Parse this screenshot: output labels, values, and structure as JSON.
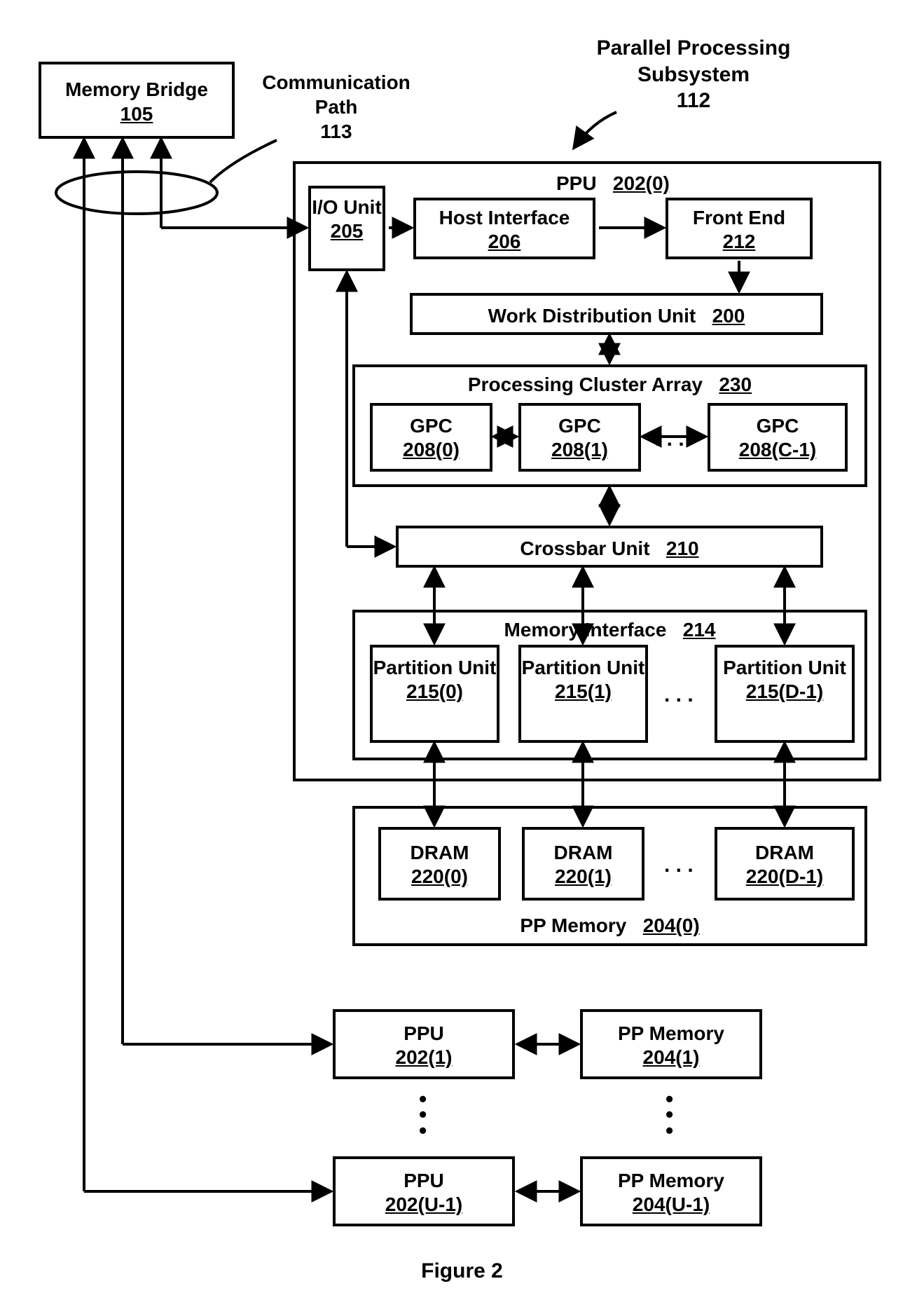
{
  "figure_caption": "Figure 2",
  "memory_bridge": {
    "title": "Memory Bridge",
    "num": "105"
  },
  "comm_path": {
    "title": "Communication Path",
    "num": "113"
  },
  "subsystem": {
    "title": "Parallel Processing Subsystem",
    "num": "112"
  },
  "ppu0": {
    "title": "PPU",
    "num": "202(0)",
    "io_unit": {
      "title": "I/O Unit",
      "num": "205"
    },
    "host_if": {
      "title": "Host Interface",
      "num": "206"
    },
    "front_end": {
      "title": "Front End",
      "num": "212"
    },
    "wdu": {
      "title": "Work Distribution Unit",
      "num": "200"
    },
    "pca": {
      "title": "Processing Cluster Array",
      "num": "230",
      "gpc0": {
        "title": "GPC",
        "num": "208(0)"
      },
      "gpc1": {
        "title": "GPC",
        "num": "208(1)"
      },
      "gpcn": {
        "title": "GPC",
        "num": "208(C-1)"
      }
    },
    "crossbar": {
      "title": "Crossbar Unit",
      "num": "210"
    },
    "mem_if": {
      "title": "Memory Interface",
      "num": "214",
      "p0": {
        "title": "Partition Unit",
        "num": "215(0)"
      },
      "p1": {
        "title": "Partition Unit",
        "num": "215(1)"
      },
      "pn": {
        "title": "Partition Unit",
        "num": "215(D-1)"
      }
    }
  },
  "ppmem0": {
    "title": "PP Memory",
    "num": "204(0)",
    "d0": {
      "title": "DRAM",
      "num": "220(0)"
    },
    "d1": {
      "title": "DRAM",
      "num": "220(1)"
    },
    "dn": {
      "title": "DRAM",
      "num": "220(D-1)"
    }
  },
  "ppu1": {
    "title": "PPU",
    "num": "202(1)"
  },
  "ppmem1": {
    "title": "PP Memory",
    "num": "204(1)"
  },
  "ppun": {
    "title": "PPU",
    "num": "202(U-1)"
  },
  "ppmemn": {
    "title": "PP Memory",
    "num": "204(U-1)"
  },
  "ellipsis": ". . ."
}
